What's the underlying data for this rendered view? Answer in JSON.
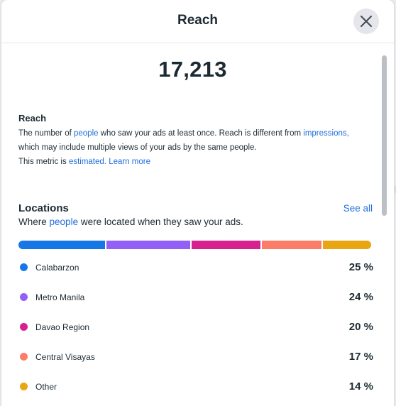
{
  "header": {
    "title": "Reach"
  },
  "metric": {
    "value": "17,213",
    "title": "Reach",
    "line1_text": "The number of",
    "line1_link": "people",
    "line1_text2": "who saw your ads at least once. Reach is different from",
    "line1_link2": "impressions,",
    "line2_text": "which may include multiple views of your ads by the same people.",
    "line3_text": "This metric is",
    "line3_link": "estimated.",
    "line3_link2": "Learn more"
  },
  "locations": {
    "title": "Locations",
    "see_all": "See all",
    "subtitle_pre": "Where",
    "subtitle_link": "people",
    "subtitle_post": "were located when they saw your ads.",
    "items": [
      {
        "label": "Calabarzon",
        "percent": "25 %",
        "value": 25,
        "color": "#1877e6"
      },
      {
        "label": "Metro Manila",
        "percent": "24 %",
        "value": 24,
        "color": "#9360f7"
      },
      {
        "label": "Davao Region",
        "percent": "20 %",
        "value": 20,
        "color": "#d6218f"
      },
      {
        "label": "Central Visayas",
        "percent": "17 %",
        "value": 17,
        "color": "#fb7c68"
      },
      {
        "label": "Other",
        "percent": "14 %",
        "value": 14,
        "color": "#e9a612"
      }
    ]
  },
  "icons": {
    "close": "close-icon"
  }
}
